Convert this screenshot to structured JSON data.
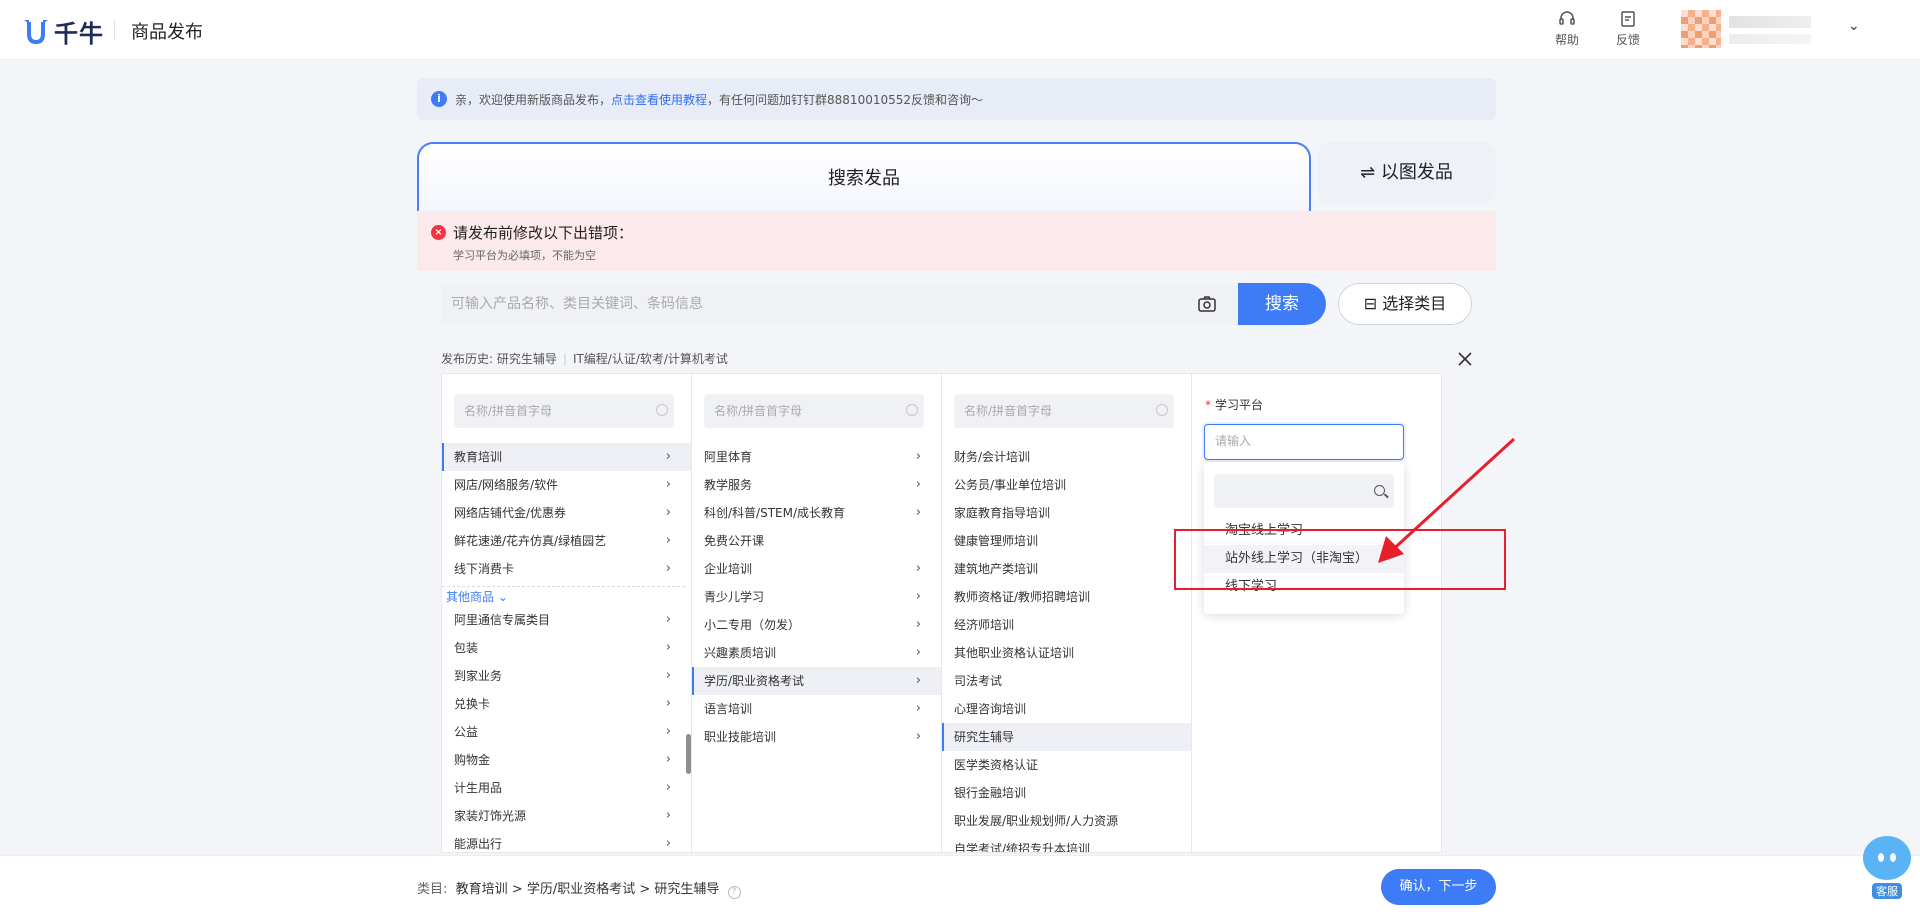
{
  "header": {
    "logo_text": "千牛",
    "page_title": "商品发布",
    "help_label": "帮助",
    "feedback_label": "反馈"
  },
  "banner": {
    "prefix": "亲，欢迎使用新版商品发布，",
    "link": "点击查看使用教程",
    "suffix": "，有任何问题加钉钉群88810010552反馈和咨询～"
  },
  "tabs": {
    "search": "搜索发品",
    "image": "⇌ 以图发品"
  },
  "error": {
    "title": "请发布前修改以下出错项：",
    "message": "学习平台为必填项，不能为空"
  },
  "search": {
    "placeholder": "可输入产品名称、类目关键词、条码信息",
    "button": "搜索",
    "category_button": "⊟ 选择类目"
  },
  "history": {
    "label": "发布历史:",
    "items": [
      "研究生辅导",
      "IT编程/认证/软考/计算机考试"
    ]
  },
  "column_search_placeholder": "名称/拼音首字母",
  "columns": {
    "col1": {
      "items": [
        "教育培训",
        "网店/网络服务/软件",
        "网络店铺代金/优惠券",
        "鲜花速递/花卉仿真/绿植园艺",
        "线下消费卡"
      ],
      "group_label": "其他商品",
      "group_items": [
        "阿里通信专属类目",
        "包装",
        "到家业务",
        "兑换卡",
        "公益",
        "购物金",
        "计生用品",
        "家装灯饰光源",
        "能源出行"
      ]
    },
    "col2": {
      "items": [
        "阿里体育",
        "教学服务",
        "科创/科普/STEM/成长教育",
        "免费公开课",
        "企业培训",
        "青少儿学习",
        "小二专用（勿发）",
        "兴趣素质培训",
        "学历/职业资格考试",
        "语言培训",
        "职业技能培训"
      ]
    },
    "col3": {
      "items": [
        "财务/会计培训",
        "公务员/事业单位培训",
        "家庭教育指导培训",
        "健康管理师培训",
        "建筑地产类培训",
        "教师资格证/教师招聘培训",
        "经济师培训",
        "其他职业资格认证培训",
        "司法考试",
        "心理咨询培训",
        "研究生辅导",
        "医学类资格认证",
        "银行金融培训",
        "职业发展/职业规划师/人力资源",
        "自学考试/统招专升本培训"
      ]
    }
  },
  "form": {
    "platform_label": "学习平台",
    "platform_placeholder": "请输入",
    "options": [
      "淘宝线上学习",
      "站外线上学习（非淘宝）",
      "线下学习"
    ]
  },
  "footer": {
    "crumb_label": "类目:",
    "crumb_path": "教育培训 > 学历/职业资格考试 > 研究生辅导",
    "confirm": "确认，下一步",
    "service": "客服"
  },
  "colors": {
    "accent": "#3d7bf7",
    "error": "#f5333f",
    "annotation_red": "#e5202c"
  }
}
